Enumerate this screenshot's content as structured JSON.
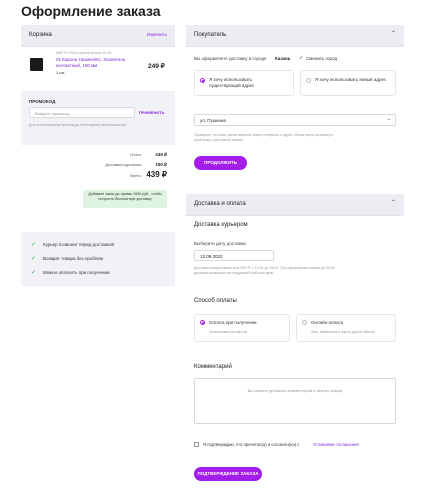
{
  "page": {
    "title": "Оформление заказа"
  },
  "cart": {
    "title": "Корзина",
    "edit_label": "Изменить",
    "item": {
      "code": "MSFT.H.Plvl.Kорзина.Белые.15-19",
      "name": "01 Корона Huawei/etc. Усилитель контактный, 100 мм",
      "qty": "1 шт.",
      "price": "249 ₽"
    },
    "promo": {
      "title": "ПРОМОКОД",
      "placeholder": "Введите промокод",
      "apply_label": "ПРИМЕНИТЬ",
      "hint": "Для использования промокода необходима авторизоваться"
    },
    "totals": {
      "subtotal_label": "Итого:",
      "subtotal_value": "249 ₽",
      "delivery_label": "Доставка курьером:",
      "delivery_value": "190 ₽",
      "total_label": "Всего:",
      "total_value": "439 ₽"
    },
    "free_delivery_note": "Добавьте заказ до суммы 1000 руб., чтобы получить бесплатную доставку"
  },
  "benefits": [
    "Курьер позвонит перед доставкой",
    "Возврат товара без проблем",
    "Можно оплатить при получении"
  ],
  "buyer": {
    "title": "Покупатель",
    "city_text": "Вы оформляете доставку в городе",
    "city": "Казань",
    "change_city": "Сменить город",
    "options": [
      {
        "label": "Я хочу использовать существующий адрес",
        "selected": true
      },
      {
        "label": "Я хочу использовать новый адрес",
        "selected": false
      }
    ],
    "address_value": "ул. Пушкина",
    "note": "Проверьте, что ваш указан верный номер телефона и адрес. Иначе могут возникнуть проблемы с доставкой заказа.",
    "continue_label": "ПРОДОЛЖИТЬ"
  },
  "delivery": {
    "title": "Доставка и оплата",
    "method_title": "Доставка курьером",
    "date_label": "Выберите дату доставки:",
    "date_value": "12.09.2022",
    "date_note": "Доставка осуществляется в ПН-ПТ с 12:00 до 18:00. При оформлении заказа до 20:00 доставка возможна на следующий рабочий день.",
    "payment_title": "Способ оплаты",
    "payment_options": [
      {
        "label": "Оплата при получении",
        "sub": "Наличными или картой",
        "selected": true
      },
      {
        "label": "Онлайн-оплата",
        "sub": "Visa, Mastercard и карты других банков",
        "selected": false
      }
    ],
    "comment_title": "Комментарий",
    "comment_placeholder": "Вы можете добавить комментарий к своему заказу",
    "agree_text": "Я подтверждаю, что прочитал(а) и согласен(на) с",
    "agree_link": "Условиями соглашения",
    "confirm_label": "ПОДТВЕРЖДЕНИЕ ЗАКАЗА"
  },
  "colors": {
    "accent": "#a31ee8",
    "panel": "#f2f2f6",
    "success_bg": "#dff3e3",
    "check": "#3fae50"
  }
}
